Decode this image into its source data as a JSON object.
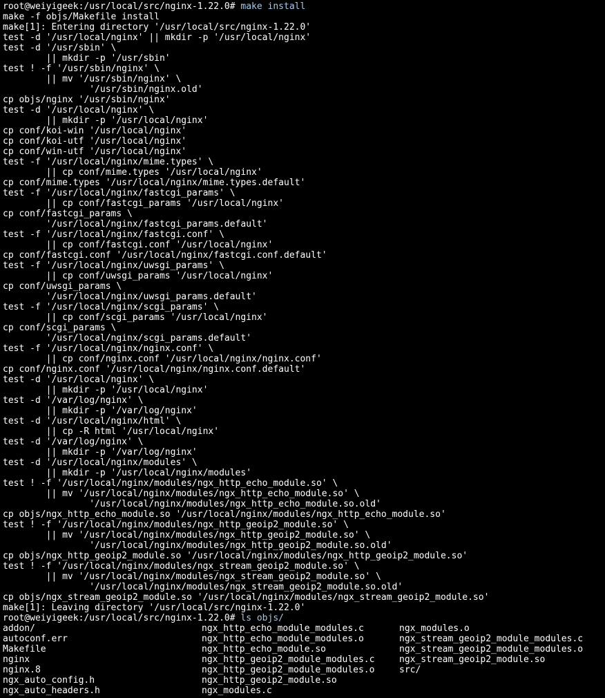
{
  "prompt1": "root@weiyigeek:/usr/local/src/nginx-1.22.0# ",
  "cmd1": "make install",
  "body": [
    "make -f objs/Makefile install",
    "make[1]: Entering directory '/usr/local/src/nginx-1.22.0'",
    "test -d '/usr/local/nginx' || mkdir -p '/usr/local/nginx'",
    "test -d '/usr/sbin' \\",
    "        || mkdir -p '/usr/sbin'",
    "test ! -f '/usr/sbin/nginx' \\",
    "        || mv '/usr/sbin/nginx' \\",
    "                '/usr/sbin/nginx.old'",
    "cp objs/nginx '/usr/sbin/nginx'",
    "test -d '/usr/local/nginx' \\",
    "        || mkdir -p '/usr/local/nginx'",
    "cp conf/koi-win '/usr/local/nginx'",
    "cp conf/koi-utf '/usr/local/nginx'",
    "cp conf/win-utf '/usr/local/nginx'",
    "test -f '/usr/local/nginx/mime.types' \\",
    "        || cp conf/mime.types '/usr/local/nginx'",
    "cp conf/mime.types '/usr/local/nginx/mime.types.default'",
    "test -f '/usr/local/nginx/fastcgi_params' \\",
    "        || cp conf/fastcgi_params '/usr/local/nginx'",
    "cp conf/fastcgi_params \\",
    "        '/usr/local/nginx/fastcgi_params.default'",
    "test -f '/usr/local/nginx/fastcgi.conf' \\",
    "        || cp conf/fastcgi.conf '/usr/local/nginx'",
    "cp conf/fastcgi.conf '/usr/local/nginx/fastcgi.conf.default'",
    "test -f '/usr/local/nginx/uwsgi_params' \\",
    "        || cp conf/uwsgi_params '/usr/local/nginx'",
    "cp conf/uwsgi_params \\",
    "        '/usr/local/nginx/uwsgi_params.default'",
    "test -f '/usr/local/nginx/scgi_params' \\",
    "        || cp conf/scgi_params '/usr/local/nginx'",
    "cp conf/scgi_params \\",
    "        '/usr/local/nginx/scgi_params.default'",
    "test -f '/usr/local/nginx/nginx.conf' \\",
    "        || cp conf/nginx.conf '/usr/local/nginx/nginx.conf'",
    "cp conf/nginx.conf '/usr/local/nginx/nginx.conf.default'",
    "test -d '/usr/local/nginx' \\",
    "        || mkdir -p '/usr/local/nginx'",
    "test -d '/var/log/nginx' \\",
    "        || mkdir -p '/var/log/nginx'",
    "test -d '/usr/local/nginx/html' \\",
    "        || cp -R html '/usr/local/nginx'",
    "test -d '/var/log/nginx' \\",
    "        || mkdir -p '/var/log/nginx'",
    "test -d '/usr/local/nginx/modules' \\",
    "        || mkdir -p '/usr/local/nginx/modules'",
    "test ! -f '/usr/local/nginx/modules/ngx_http_echo_module.so' \\",
    "        || mv '/usr/local/nginx/modules/ngx_http_echo_module.so' \\",
    "                '/usr/local/nginx/modules/ngx_http_echo_module.so.old'",
    "cp objs/ngx_http_echo_module.so '/usr/local/nginx/modules/ngx_http_echo_module.so'",
    "test ! -f '/usr/local/nginx/modules/ngx_http_geoip2_module.so' \\",
    "        || mv '/usr/local/nginx/modules/ngx_http_geoip2_module.so' \\",
    "                '/usr/local/nginx/modules/ngx_http_geoip2_module.so.old'",
    "cp objs/ngx_http_geoip2_module.so '/usr/local/nginx/modules/ngx_http_geoip2_module.so'",
    "test ! -f '/usr/local/nginx/modules/ngx_stream_geoip2_module.so' \\",
    "        || mv '/usr/local/nginx/modules/ngx_stream_geoip2_module.so' \\",
    "                '/usr/local/nginx/modules/ngx_stream_geoip2_module.so.old'",
    "cp objs/ngx_stream_geoip2_module.so '/usr/local/nginx/modules/ngx_stream_geoip2_module.so'",
    "make[1]: Leaving directory '/usr/local/src/nginx-1.22.0'"
  ],
  "prompt2": "root@weiyigeek:/usr/local/src/nginx-1.22.0# ",
  "cmd2": "ls objs/",
  "ls": {
    "rows": [
      [
        "addon/",
        "ngx_http_echo_module_modules.c",
        "ngx_modules.o"
      ],
      [
        "autoconf.err",
        "ngx_http_echo_module_modules.o",
        "ngx_stream_geoip2_module_modules.c"
      ],
      [
        "Makefile",
        "ngx_http_echo_module.so",
        "ngx_stream_geoip2_module_modules.o"
      ],
      [
        "nginx",
        "ngx_http_geoip2_module_modules.c",
        "ngx_stream_geoip2_module.so"
      ],
      [
        "nginx.8",
        "ngx_http_geoip2_module_modules.o",
        "src/"
      ],
      [
        "ngx_auto_config.h",
        "ngx_http_geoip2_module.so",
        ""
      ],
      [
        "ngx_auto_headers.h",
        "ngx_modules.c",
        ""
      ]
    ]
  }
}
